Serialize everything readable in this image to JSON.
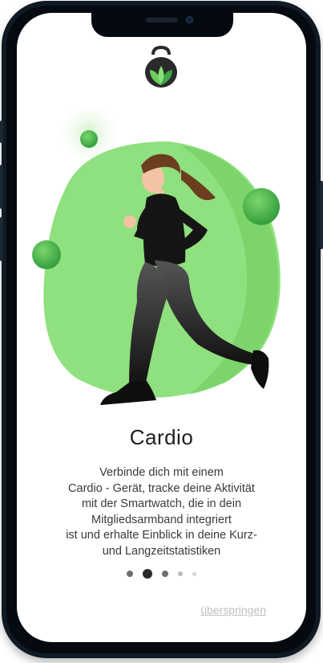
{
  "onboarding": {
    "title": "Cardio",
    "description_lines": [
      "Verbinde dich mit einem",
      "Cardio - Gerät, tracke deine Aktivität",
      "mit der Smartwatch, die in dein",
      "Mitgliedsarmband integriert",
      "ist und erhalte Einblick in deine Kurz-",
      "und Langzeitstatistiken"
    ],
    "skip_label": "überspringen",
    "page_count": 5,
    "active_page": 2
  },
  "colors": {
    "accent_light": "#8fe07e",
    "accent": "#5fc24e",
    "accent_dark": "#2f8f3a",
    "dot_active": "#2b2b2b",
    "dot_inactive": "#7a7a7a"
  },
  "icons": {
    "logo": "kettlebell-leaf-logo-icon"
  }
}
